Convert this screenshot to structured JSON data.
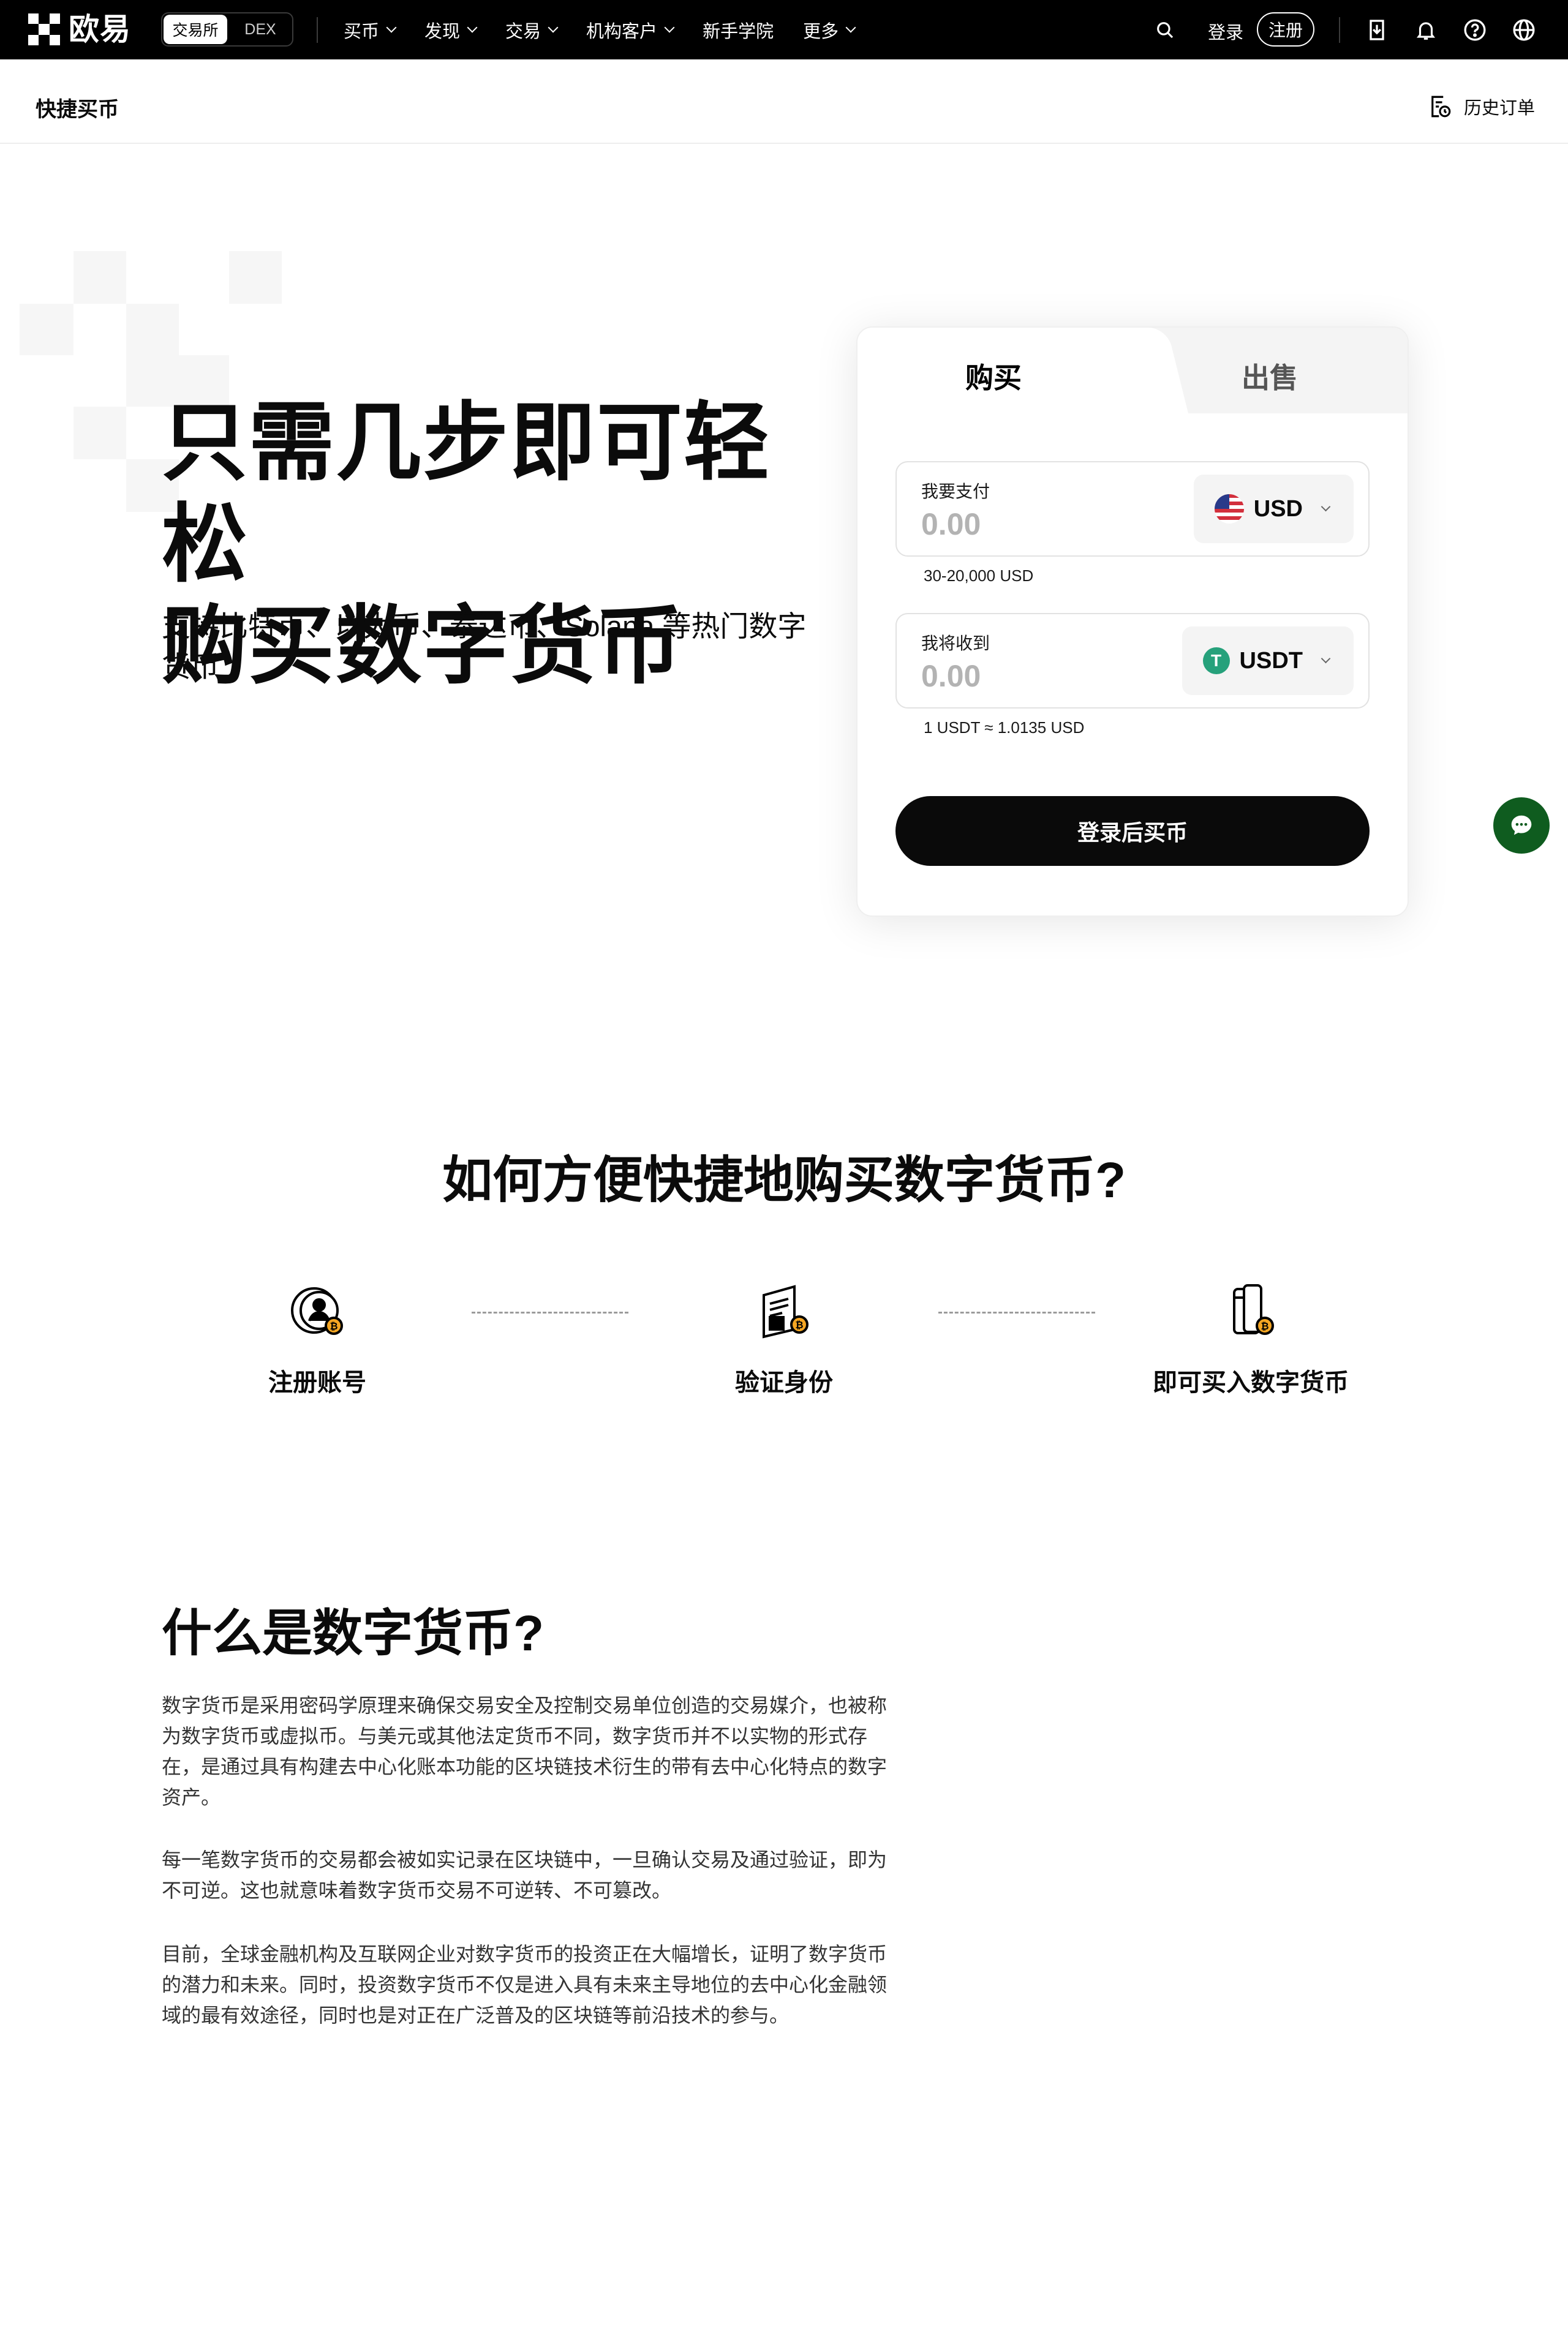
{
  "nav": {
    "brand": "欧易",
    "segment": [
      "交易所",
      "DEX"
    ],
    "menu": [
      "买币",
      "发现",
      "交易",
      "机构客户",
      "新手学院",
      "更多"
    ],
    "login": "登录",
    "register": "注册"
  },
  "subheader": {
    "title": "快捷买币",
    "history": "历史订单"
  },
  "hero": {
    "title_line1": "只需几步即可轻松",
    "title_line2": "购买数字货币",
    "subtitle": "支持比特币、以太币、泰达币、Solana 等热门数字货币"
  },
  "card": {
    "tab_buy": "购买",
    "tab_sell": "出售",
    "pay": {
      "label": "我要支付",
      "value": "0.00",
      "currency": "USD",
      "hint": "30-20,000 USD"
    },
    "receive": {
      "label": "我将收到",
      "value": "0.00",
      "currency": "USDT",
      "hint": "1 USDT ≈ 1.0135 USD"
    },
    "cta": "登录后买币"
  },
  "how": {
    "title": "如何方便快捷地购买数字货币?",
    "steps": [
      "注册账号",
      "验证身份",
      "即可买入数字货币"
    ]
  },
  "what": {
    "title": "什么是数字货币?",
    "paragraphs": [
      "数字货币是采用密码学原理来确保交易安全及控制交易单位创造的交易媒介，也被称为数字货币或虚拟币。与美元或其他法定货币不同，数字货币并不以实物的形式存在，是通过具有构建去中心化账本功能的区块链技术衍生的带有去中心化特点的数字资产。",
      "每一笔数字货币的交易都会被如实记录在区块链中，一旦确认交易及通过验证，即为不可逆。这也就意味着数字货币交易不可逆转、不可篡改。",
      "目前，全球金融机构及互联网企业对数字货币的投资正在大幅增长，证明了数字货币的潜力和未来。同时，投资数字货币不仅是进入具有未来主导地位的去中心化金融领域的最有效途径，同时也是对正在广泛普及的区块链等前沿技术的参与。"
    ]
  },
  "colors": {
    "accent": "#0a0a0a",
    "usdt": "#26a17b",
    "chat": "#0f5c1f"
  }
}
